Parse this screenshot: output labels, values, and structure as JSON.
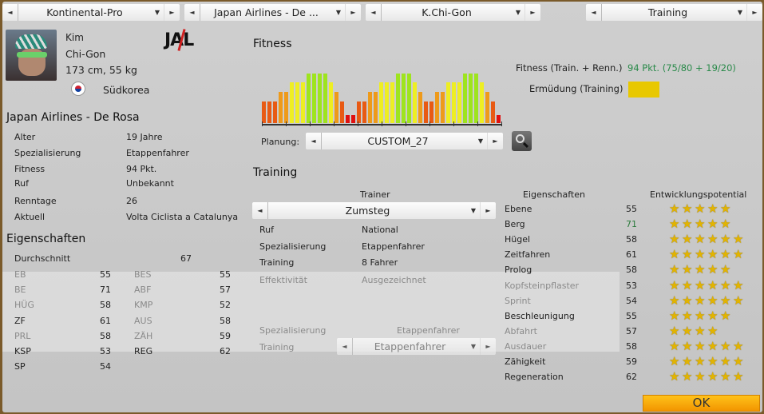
{
  "top_selectors": [
    {
      "value": "Kontinental-Pro"
    },
    {
      "value": "Japan Airlines - De ..."
    },
    {
      "value": "K.Chi-Gon"
    },
    {
      "value": "Training"
    }
  ],
  "rider": {
    "first_name": "Kim",
    "last_name": "Chi-Gon",
    "body": "173 cm, 55 kg",
    "country": "Südkorea",
    "team_logo": "JAL",
    "team": "Japan Airlines - De Rosa"
  },
  "info": [
    {
      "label": "Alter",
      "value": "19 Jahre"
    },
    {
      "label": "Spezialisierung",
      "value": "Etappenfahrer"
    },
    {
      "label": "Fitness",
      "value": "94 Pkt."
    },
    {
      "label": "Ruf",
      "value": "Unbekannt"
    },
    {
      "label": "Renntage",
      "value": "26"
    },
    {
      "label": "Aktuell",
      "value": "Volta Ciclista a Catalunya"
    }
  ],
  "attributes_short": {
    "title": "Eigenschaften",
    "average_label": "Durchschnitt",
    "average_value": "67",
    "left": [
      [
        "EB",
        "55"
      ],
      [
        "BE",
        "71"
      ],
      [
        "HÜG",
        "58"
      ],
      [
        "ZF",
        "61"
      ],
      [
        "PRL",
        "58"
      ],
      [
        "KSP",
        "53"
      ],
      [
        "SP",
        "54"
      ]
    ],
    "right": [
      [
        "BES",
        "55"
      ],
      [
        "ABF",
        "57"
      ],
      [
        "KMP",
        "52"
      ],
      [
        "AUS",
        "58"
      ],
      [
        "ZÄH",
        "59"
      ],
      [
        "REG",
        "62"
      ]
    ]
  },
  "fitness": {
    "title": "Fitness",
    "plan_levels": [
      2,
      2,
      2,
      3,
      3,
      4,
      4,
      4,
      5,
      5,
      5,
      5,
      4,
      3,
      2,
      1,
      1,
      2,
      2,
      3,
      3,
      4,
      4,
      4,
      5,
      5,
      5,
      4,
      3,
      2,
      2,
      3,
      3,
      4,
      4,
      4,
      5,
      5,
      5,
      4,
      3,
      2,
      1
    ],
    "level_colors": {
      "1": "#e01010",
      "2": "#e85a14",
      "3": "#ee9a1a",
      "4": "#eeee22",
      "5": "#9ee41e"
    },
    "planning_label": "Planung:",
    "planning_value": "CUSTOM_27",
    "total_label": "Fitness (Train. + Renn.)",
    "total_value": "94 Pkt. (75/80 + 19/20)",
    "fatigue_label": "Ermüdung (Training)",
    "fatigue_color": "#e8c800"
  },
  "training": {
    "title": "Training",
    "trainer_label": "Trainer",
    "trainer_value": "Zumsteg",
    "rows": [
      {
        "label": "Ruf",
        "value": "National"
      },
      {
        "label": "Spezialisierung",
        "value": "Etappenfahrer"
      },
      {
        "label": "Training",
        "value": "8 Fahrer"
      },
      {
        "label": "Effektivität",
        "value": "Ausgezeichnet"
      }
    ],
    "spec_label": "Spezialisierung",
    "spec_value": "Etappenfahrer",
    "training_label": "Training",
    "training_value": "Etappenfahrer"
  },
  "attributes": {
    "header_name": "Eigenschaften",
    "header_potential": "Entwicklungspotential",
    "rows": [
      {
        "name": "Ebene",
        "value": "55",
        "stars": 5
      },
      {
        "name": "Berg",
        "value": "71",
        "stars": 5
      },
      {
        "name": "Hügel",
        "value": "58",
        "stars": 6
      },
      {
        "name": "Zeitfahren",
        "value": "61",
        "stars": 6
      },
      {
        "name": "Prolog",
        "value": "58",
        "stars": 5
      },
      {
        "name": "Kopfsteinpflaster",
        "value": "53",
        "stars": 6
      },
      {
        "name": "Sprint",
        "value": "54",
        "stars": 6
      },
      {
        "name": "Beschleunigung",
        "value": "55",
        "stars": 5
      },
      {
        "name": "Abfahrt",
        "value": "57",
        "stars": 4
      },
      {
        "name": "Ausdauer",
        "value": "58",
        "stars": 6
      },
      {
        "name": "Zähigkeit",
        "value": "59",
        "stars": 6
      },
      {
        "name": "Regeneration",
        "value": "62",
        "stars": 6
      }
    ]
  },
  "ok_label": "OK"
}
